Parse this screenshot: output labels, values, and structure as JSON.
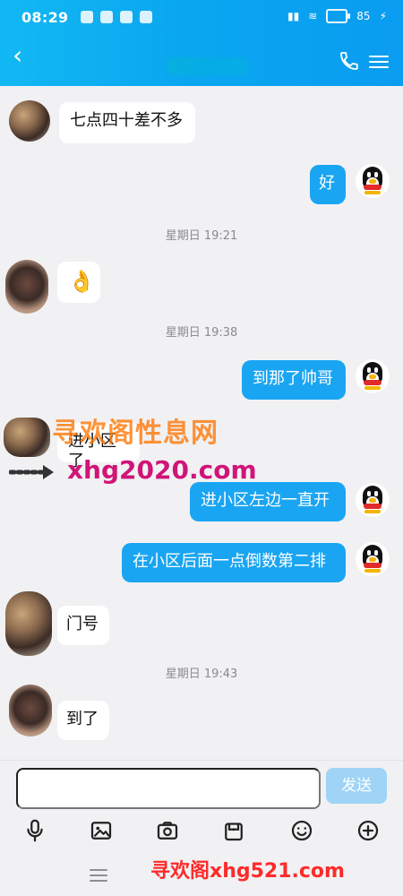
{
  "status_bar": {
    "time": "08:29",
    "battery_text": "85"
  },
  "header": {
    "back_label": "‹"
  },
  "chat": {
    "messages": [
      {
        "side": "left",
        "text": "七点四十差不多"
      },
      {
        "side": "right",
        "text": "好"
      },
      {
        "side": "time",
        "text": "星期日 19:21"
      },
      {
        "side": "left",
        "emoji": "👌"
      },
      {
        "side": "time",
        "text": "星期日 19:38"
      },
      {
        "side": "right",
        "text": "到那了帅哥"
      },
      {
        "side": "left",
        "text": "进小区了"
      },
      {
        "side": "right",
        "text": "进小区左边一直开"
      },
      {
        "side": "right",
        "text": "在小区后面一点倒数第二排"
      },
      {
        "side": "left",
        "text": "门号"
      },
      {
        "side": "time",
        "text": "星期日 19:43"
      },
      {
        "side": "left",
        "text": "到了"
      }
    ]
  },
  "watermarks": {
    "top_cn": "寻欢阁性息网",
    "top_url": "xhg2020.com",
    "bottom": "寻欢阁xhg521.com"
  },
  "input": {
    "placeholder": "",
    "send_label": "发送"
  },
  "colors": {
    "header": "#0aa7f0",
    "bubble_right": "#1aa5f2",
    "send_disabled": "#9fd4f6"
  },
  "icons": [
    "mic-icon",
    "image-icon",
    "camera-icon",
    "gift-icon",
    "emoji-icon",
    "plus-icon",
    "back-icon",
    "phone-icon",
    "menu-icon",
    "qq-avatar-icon"
  ]
}
